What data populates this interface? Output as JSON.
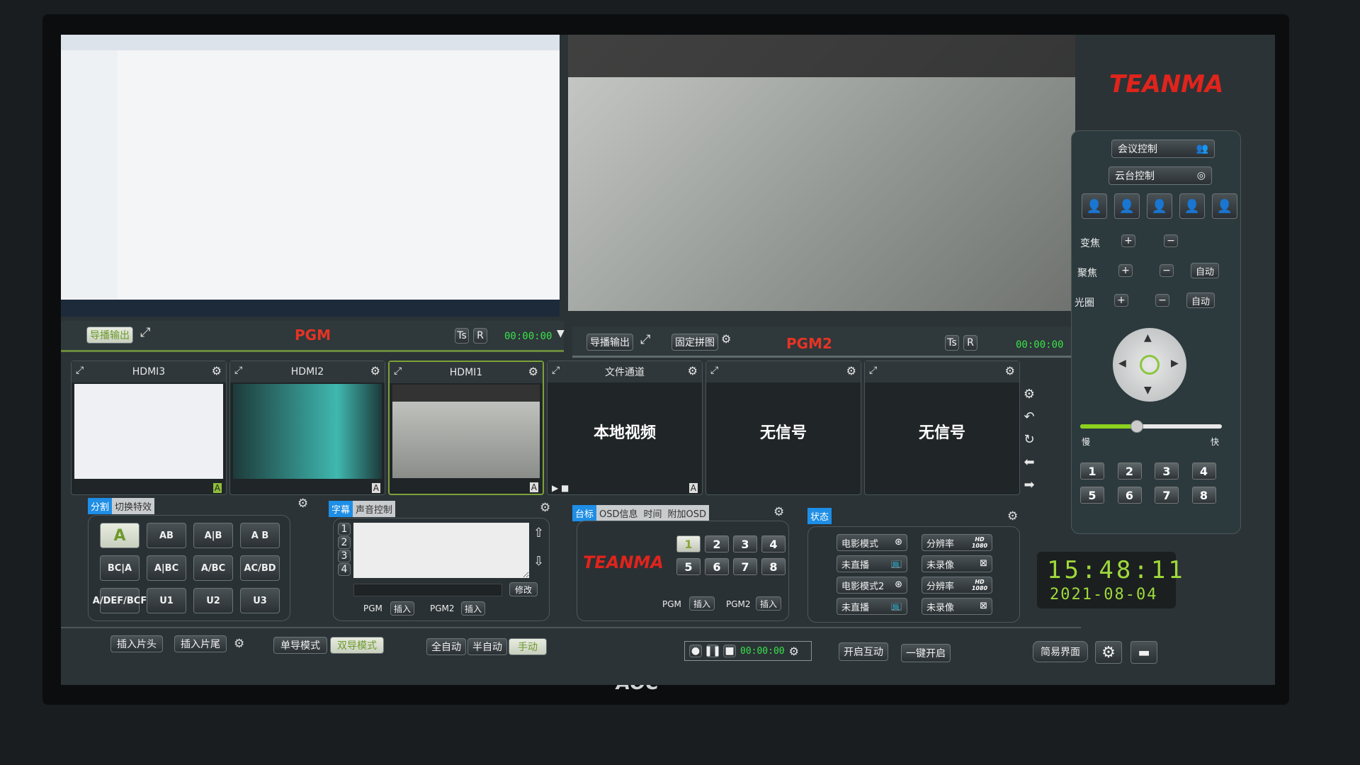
{
  "brand": {
    "logo_text": "TEANMA",
    "logo_color": "#e0241c"
  },
  "monitor": {
    "brand": "AOC"
  },
  "pgm_bar": {
    "output_btn": "导播输出",
    "title": "PGM",
    "ts": "Ts",
    "r": "R",
    "timer": "00:00:00"
  },
  "pgm2_bar": {
    "output_btn": "导播输出",
    "fixed_btn": "固定拼图",
    "title": "PGM2",
    "ts": "Ts",
    "r": "R",
    "timer": "00:00:00"
  },
  "sources": [
    {
      "name": "HDMI3",
      "content": "",
      "badge": "A"
    },
    {
      "name": "HDMI2",
      "content": "",
      "badge": "A"
    },
    {
      "name": "HDMI1",
      "content": "",
      "badge": "A",
      "selected": true
    },
    {
      "name": "文件通道",
      "content": "本地视频",
      "badge": "A"
    },
    {
      "name": "",
      "content": "无信号",
      "badge": ""
    },
    {
      "name": "",
      "content": "无信号",
      "badge": ""
    }
  ],
  "split_panel": {
    "tabs": [
      "分割",
      "切换特效"
    ],
    "active_tab": "分割",
    "layouts": [
      "A",
      "AB",
      "A|B",
      "A B",
      "BC|A",
      "A|BC",
      "A/BC",
      "AC/BD",
      "A/DEF/BCF",
      "U1",
      "U2",
      "U3"
    ]
  },
  "caption_panel": {
    "tabs": [
      "字幕",
      "声音控制"
    ],
    "active_tab": "字幕",
    "lines": [
      "1",
      "2",
      "3",
      "4"
    ],
    "modify_btn": "修改",
    "pgm_label": "PGM",
    "pgm_insert": "插入",
    "pgm2_label": "PGM2",
    "pgm2_insert": "插入"
  },
  "logo_panel": {
    "tabs": [
      "台标",
      "OSD信息",
      "时间",
      "附加OSD"
    ],
    "active_tab": "台标",
    "slots": [
      "1",
      "2",
      "3",
      "4",
      "5",
      "6",
      "7",
      "8"
    ],
    "active_slot": "1",
    "pgm_label": "PGM",
    "pgm_insert": "插入",
    "pgm2_label": "PGM2",
    "pgm2_insert": "插入"
  },
  "status_panel": {
    "tab": "状态",
    "items": [
      "电影模式",
      "分辨率",
      "未直播",
      "未录像",
      "电影模式2",
      "分辨率",
      "未直播",
      "未录像"
    ],
    "hd_badge": "HD 1080"
  },
  "bottom_bar": {
    "insert_head": "插入片头",
    "insert_tail": "插入片尾",
    "single_mode": "单导模式",
    "dual_mode": "双导模式",
    "full_auto": "全自动",
    "semi_auto": "半自动",
    "manual": "手动",
    "rec_timer": "00:00:00",
    "interact": "开启互动",
    "one_key": "一键开启",
    "simple_ui": "简易界面"
  },
  "control_panel": {
    "meeting": "会议控制",
    "ptz": "云台控制",
    "zoom": "变焦",
    "focus": "聚焦",
    "iris": "光圈",
    "auto": "自动",
    "slow": "慢",
    "fast": "快",
    "speed_percent": 40,
    "presets": [
      "1",
      "2",
      "3",
      "4",
      "5",
      "6",
      "7",
      "8"
    ]
  },
  "clock": {
    "time": "15:48:11",
    "date": "2021-08-04"
  }
}
